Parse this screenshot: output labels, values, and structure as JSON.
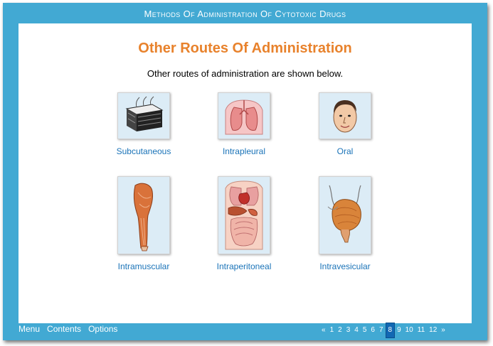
{
  "header": {
    "title": "Methods Of Administration Of Cytotoxic Drugs"
  },
  "main": {
    "title": "Other Routes Of Administration",
    "intro": "Other routes of administration are shown below.",
    "routes": [
      {
        "label": "Subcutaneous",
        "icon": "skin-layers-icon"
      },
      {
        "label": "Intrapleural",
        "icon": "lungs-icon"
      },
      {
        "label": "Oral",
        "icon": "face-icon"
      },
      {
        "label": "Intramuscular",
        "icon": "arm-muscle-icon"
      },
      {
        "label": "Intraperitoneal",
        "icon": "abdomen-organs-icon"
      },
      {
        "label": "Intravesicular",
        "icon": "bladder-icon"
      }
    ]
  },
  "footer": {
    "menu": [
      "Menu",
      "Contents",
      "Options"
    ],
    "pager": {
      "prev": "«",
      "pages": [
        "1",
        "2",
        "3",
        "4",
        "5",
        "6",
        "7",
        "8",
        "9",
        "10",
        "11",
        "12"
      ],
      "current": "8",
      "next": "»"
    }
  },
  "colors": {
    "frame": "#42a9d3",
    "title": "#e8822c",
    "link": "#1a73b8",
    "current_page": "#1268b3"
  }
}
